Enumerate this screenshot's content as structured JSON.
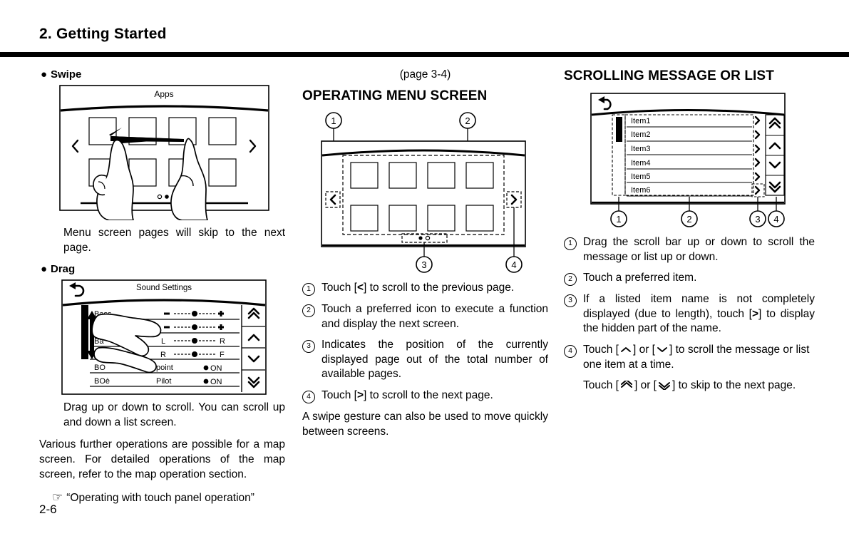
{
  "header": {
    "chapter_title": "2. Getting Started"
  },
  "page_number": "2-6",
  "column_left": {
    "swipe": {
      "bullet": "●",
      "label": "Swipe",
      "figure": {
        "name": "apps-screen",
        "screen_title": "Apps",
        "prev_icon": "chevron-left",
        "next_icon": "chevron-right",
        "icon_count": 8,
        "page_dots": [
          "filled",
          "hollow"
        ]
      },
      "caption": "Menu screen pages will skip to the next page."
    },
    "drag": {
      "bullet": "●",
      "label": "Drag",
      "figure": {
        "name": "sound-settings-screen",
        "screen_title": "Sound Settings",
        "back_icon": "back-arrow",
        "rows": [
          {
            "label": "Bass",
            "control": "slider",
            "left_mark": "−",
            "right_mark": "+"
          },
          {
            "label": "",
            "control": "slider",
            "left_mark": "−",
            "right_mark": "+"
          },
          {
            "label": "Ba",
            "control": "slider",
            "left_mark": "L",
            "right_mark": "R"
          },
          {
            "label": "",
            "control": "slider",
            "left_mark": "R",
            "right_mark": "F"
          },
          {
            "label": "BO",
            "control": "toggle",
            "value_label": "point",
            "state": "ON"
          },
          {
            "label": "BOè",
            "control": "toggle",
            "value_label": "Pilot",
            "state": "ON"
          }
        ],
        "scroll_buttons": [
          "double-up",
          "up",
          "down",
          "double-down"
        ]
      },
      "caption": "Drag up or down to scroll. You can scroll up and down a list screen."
    },
    "closing_paragraph": "Various further operations are possible for a map screen. For detailed operations of the map screen, refer to the map operation section.",
    "cross_reference": {
      "icon": "pointing-hand-icon",
      "text": "“Operating with touch panel operation”"
    }
  },
  "column_center": {
    "page_ref": "(page 3-4)",
    "section_heading": "OPERATING MENU SCREEN",
    "figure": {
      "name": "operating-menu-screen",
      "callouts_top": [
        "1",
        "2"
      ],
      "callouts_bottom": [
        "3",
        "4"
      ],
      "prev_icon": "chevron-left",
      "next_icon": "chevron-right",
      "icon_count": 8,
      "page_dots": [
        "filled",
        "hollow"
      ]
    },
    "items": [
      {
        "num": "1",
        "text_before": "Touch [",
        "key": "<",
        "text_after": "] to scroll to the previous page."
      },
      {
        "num": "2",
        "text_before": "",
        "key": "",
        "text_after": "Touch a preferred icon to execute a function and display the next screen."
      },
      {
        "num": "3",
        "text_before": "",
        "key": "",
        "text_after": "Indicates the position of the currently displayed page out of the total number of available pages."
      },
      {
        "num": "4",
        "text_before": "Touch [",
        "key": ">",
        "text_after": "] to scroll to the next page."
      }
    ],
    "closing_paragraph": "A swipe gesture can also be used to move quickly between screens."
  },
  "column_right": {
    "section_heading": "SCROLLING MESSAGE OR LIST",
    "figure": {
      "name": "scrolling-list-screen",
      "back_icon": "back-arrow",
      "scrollbar": "scrollbar-thumb",
      "items": [
        "Item1",
        "Item2",
        "Item3",
        "Item4",
        "Item5",
        "Item6"
      ],
      "row_arrow_icon": "chevron-right",
      "scroll_buttons": [
        "double-up",
        "up",
        "down",
        "double-down"
      ],
      "callouts_bottom": [
        "1",
        "2",
        "3",
        "4"
      ]
    },
    "items": [
      {
        "num": "1",
        "text": "Drag the scroll bar up or down to scroll the message or list up or down."
      },
      {
        "num": "2",
        "text": "Touch a preferred item."
      },
      {
        "num": "3",
        "text_before": "If a listed item name is not completely displayed (due to length), touch [",
        "key": ">",
        "text_after": "] to display the hidden part of the name."
      },
      {
        "num": "4",
        "text_before": "Touch [",
        "key1": "∧",
        "text_mid": "] or [",
        "key2": "∨",
        "text_after": "] to scroll the message or list one item at a time.",
        "second_before": "Touch [",
        "second_key1": "»",
        "second_mid": "] or [",
        "second_key2": "»",
        "second_after": "] to skip to the next page."
      }
    ]
  }
}
